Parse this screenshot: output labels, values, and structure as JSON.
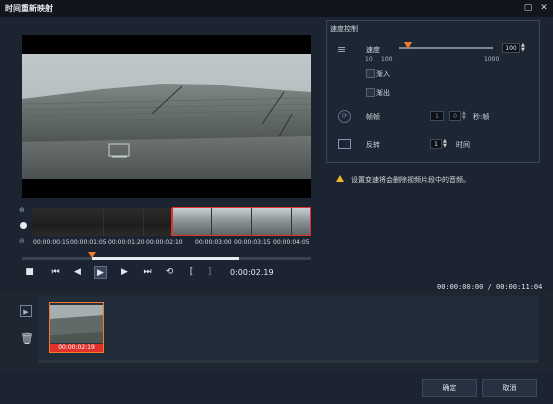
{
  "window": {
    "title": "时间重新映射",
    "maximize_icon": "maximize-icon",
    "close_icon": "close-icon"
  },
  "timeline": {
    "timecodes": [
      "00:00:00:15",
      "00:00:01:05",
      "00:00:01:20",
      "00:00:02:10",
      "00:00:03:00",
      "00:00:03:15",
      "00:00:04:05"
    ],
    "progress_fraction": 0.51
  },
  "transport": {
    "current_time": "0:00:02.19",
    "total_time_display": "00:00:00:00 / 00:00:11:04",
    "in_mark": "[",
    "out_mark": "]"
  },
  "speed_control": {
    "section_title": "速度控制",
    "speed_label": "速度",
    "speed_value": "100",
    "slider_min_label": "10",
    "slider_mid_label": "100",
    "slider_max_label": "1000",
    "speed_fraction": 0.09,
    "fade_in_label": "渐入",
    "fade_out_label": "渐出",
    "freeze_label": "帧帧",
    "freeze_seconds": "1",
    "freeze_frames": "0",
    "freeze_unit": "秒:帧",
    "reverse_label": "反转",
    "reverse_count": "1",
    "reverse_unit": "时间"
  },
  "warning": {
    "text": "设置变速将会删除视频片段中的音频。"
  },
  "clip_bin": {
    "clips": [
      {
        "timecode": "00:00:02:19"
      }
    ]
  },
  "buttons": {
    "ok": "确定",
    "cancel": "取消"
  },
  "colors": {
    "accent": "#e0322a",
    "clip_border": "#f07a30"
  }
}
